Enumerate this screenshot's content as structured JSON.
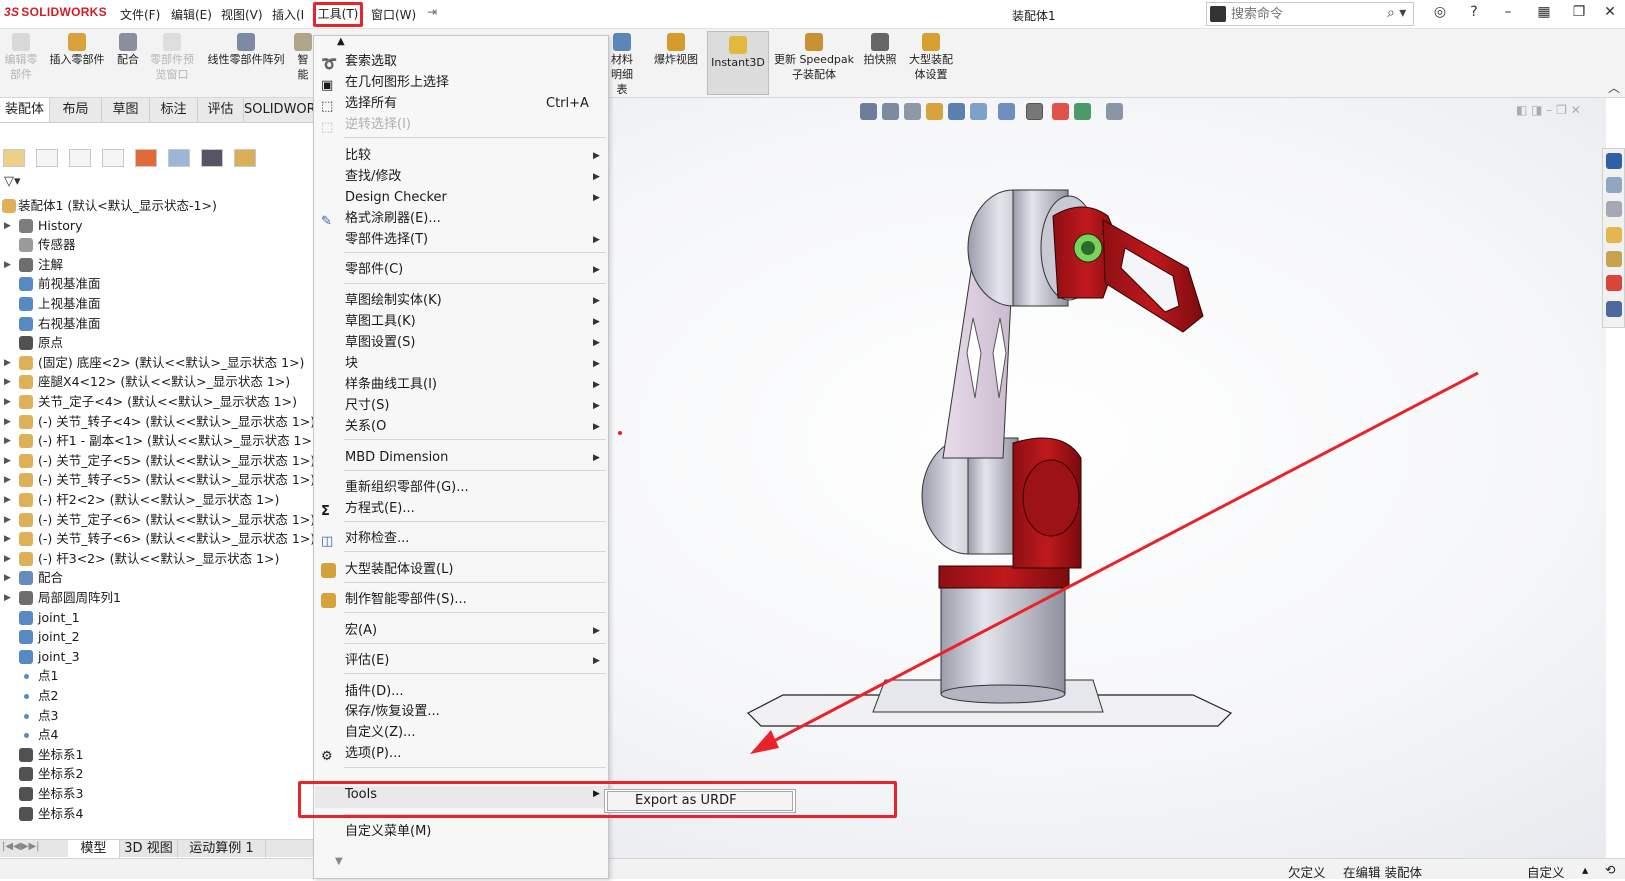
{
  "app": {
    "logo_prefix": "3S",
    "logo_name": "SOLIDWORKS",
    "doc_title": "装配体1"
  },
  "menubar": {
    "file": "文件(F)",
    "edit": "编辑(E)",
    "view": "视图(V)",
    "insert": "插入(I",
    "tools": "工具(T)",
    "window": "窗口(W)"
  },
  "search": {
    "placeholder": "搜索命令"
  },
  "commands": {
    "edit_part": "编辑零部件",
    "insert_part": "插入零部件",
    "mate": "配合",
    "part_preview": "零部件预览窗口",
    "linear_pattern": "线性零部件阵列",
    "smart": "智能",
    "bom": "材料明细表",
    "explode": "爆炸视图",
    "instant3d": "Instant3D",
    "speedpak": "更新 Speedpak 子装配体",
    "snapshot": "拍快照",
    "large_asm": "大型装配体设置"
  },
  "tabs": [
    "装配体",
    "布局",
    "草图",
    "标注",
    "评估",
    "SOLIDWOR"
  ],
  "tree": {
    "root": "装配体1 (默认<默认_显示状态-1>)",
    "items": [
      "History",
      "传感器",
      "注解",
      "前视基准面",
      "上视基准面",
      "右视基准面",
      "原点",
      "(固定) 底座<2> (默认<<默认>_显示状态 1>)",
      "座腿X4<12> (默认<<默认>_显示状态 1>)",
      "关节_定子<4> (默认<<默认>_显示状态 1>)",
      "(-) 关节_转子<4> (默认<<默认>_显示状态 1>)",
      "(-) 杆1 - 副本<1> (默认<<默认>_显示状态 1>)",
      "(-) 关节_定子<5> (默认<<默认>_显示状态 1>)",
      "(-) 关节_转子<5> (默认<<默认>_显示状态 1>)",
      "(-) 杆2<2> (默认<<默认>_显示状态 1>)",
      "(-) 关节_定子<6> (默认<<默认>_显示状态 1>)",
      "(-) 关节_转子<6> (默认<<默认>_显示状态 1>)",
      "(-) 杆3<2> (默认<<默认>_显示状态 1>)",
      "配合",
      "局部圆周阵列1",
      "joint_1",
      "joint_2",
      "joint_3",
      "点1",
      "点2",
      "点3",
      "点4",
      "坐标系1",
      "坐标系2",
      "坐标系3",
      "坐标系4"
    ]
  },
  "bottom_tabs": [
    "模型",
    "3D 视图",
    "运动算例 1"
  ],
  "status": {
    "defined": "欠定义",
    "editing": "在编辑 装配体",
    "custom": "自定义"
  },
  "tools_menu": {
    "lasso": "套索选取",
    "select_geom": "在几何图形上选择",
    "select_all": "选择所有",
    "select_all_key": "Ctrl+A",
    "invert": "逆转选择(I)",
    "compare": "比较",
    "find_modify": "查找/修改",
    "design_checker": "Design Checker",
    "format_painter": "格式涂刷器(E)...",
    "comp_select": "零部件选择(T)",
    "component": "零部件(C)",
    "sketch_entities": "草图绘制实体(K)",
    "sketch_tools": "草图工具(K)",
    "sketch_settings": "草图设置(S)",
    "block": "块",
    "spline_tools": "样条曲线工具(I)",
    "dimensions": "尺寸(S)",
    "relations": "关系(O",
    "mbd": "MBD Dimension",
    "reorganize": "重新组织零部件(G)...",
    "equations": "方程式(E)...",
    "symmetry": "对称检查...",
    "large_asm_settings": "大型装配体设置(L)",
    "smart_comp": "制作智能零部件(S)...",
    "macro": "宏(A)",
    "evaluate": "评估(E)",
    "addins": "插件(D)...",
    "save_restore": "保存/恢复设置...",
    "customize": "自定义(Z)...",
    "options": "选项(P)...",
    "tools": "Tools",
    "custom_menu": "自定义菜单(M)"
  },
  "submenu": {
    "export_urdf": "Export as URDF"
  },
  "colors": {
    "accent_red": "#e8232a",
    "model_red": "#b8161a",
    "model_gray": "#cfd0d8"
  }
}
